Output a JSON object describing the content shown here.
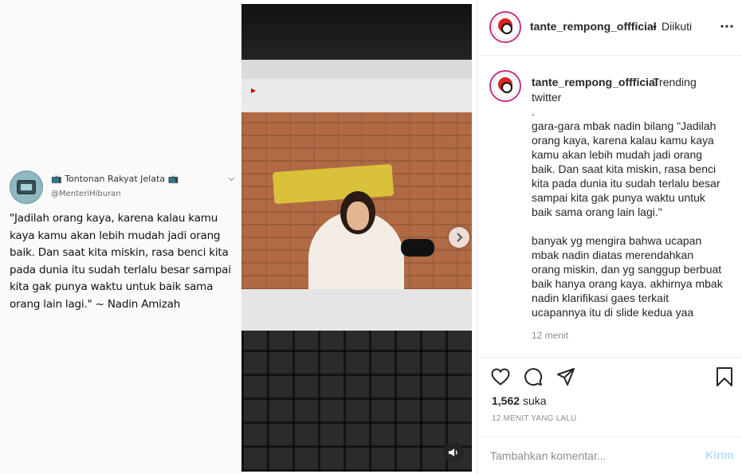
{
  "tweet": {
    "name": "📺 Tontonan Rakyat Jelata 📺",
    "handle": "@MenteriHiburan",
    "lines": [
      "\"Jadilah orang kaya, karena kalau kamu",
      "kaya kamu akan lebih mudah jadi orang",
      "baik. Dan saat kita miskin, rasa benci kita",
      "pada dunia itu sudah terlalu besar sampai",
      "kita gak punya waktu untuk baik sama",
      "orang lain lagi.\" ~ Nadin Amizah"
    ]
  },
  "video": {
    "next_icon": "chevron-right-icon",
    "mute_icon": "speaker-icon"
  },
  "header": {
    "username": "tante_rempong_offficial",
    "separator": "•",
    "follow_status": "Diikuti"
  },
  "caption": {
    "username": "tante_rempong_offficial",
    "head_text": "Trending",
    "lines": [
      "twitter",
      ".",
      "gara-gara mbak nadin bilang \"Jadilah",
      "orang kaya, karena kalau kamu kaya",
      "kamu akan lebih mudah jadi orang",
      "baik. Dan saat kita miskin, rasa benci",
      "kita pada dunia itu sudah terlalu besar",
      "sampai kita gak punya waktu untuk",
      "baik sama orang lain lagi.\"",
      "",
      "banyak yg mengira bahwa ucapan",
      "mbak nadin diatas merendahkan",
      "orang miskin, dan yg sanggup berbuat",
      "baik hanya orang kaya. akhirnya mbak",
      "nadin klarifikasi gaes terkait",
      "ucapannya itu di slide kedua yaa"
    ],
    "time": "12 menit"
  },
  "actions": {
    "likes_number": "1,562",
    "likes_label": "suka",
    "post_time": "12 MENIT YANG LALU"
  },
  "comment": {
    "placeholder": "Tambahkan komentar...",
    "post_label": "Kirim"
  },
  "colors": {
    "post_button": "#b2dffc",
    "avatar_ring": "#c13584"
  }
}
